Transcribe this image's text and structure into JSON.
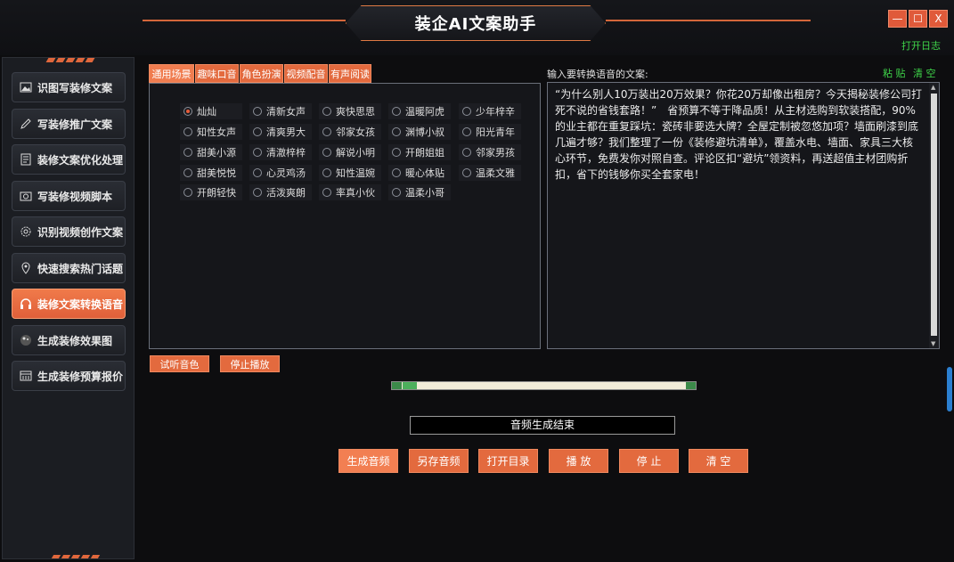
{
  "window": {
    "title": "装企AI文案助手",
    "open_log": "打开日志",
    "minimize": "—",
    "maximize": "☐",
    "close": "X"
  },
  "sidebar": {
    "items": [
      {
        "label": "识图写装修文案",
        "icon": "image-icon"
      },
      {
        "label": "写装修推广文案",
        "icon": "pen-icon"
      },
      {
        "label": "装修文案优化处理",
        "icon": "document-icon"
      },
      {
        "label": "写装修视频脚本",
        "icon": "camera-icon"
      },
      {
        "label": "识别视频创作文案",
        "icon": "gear-icon"
      },
      {
        "label": "快速搜索热门话题",
        "icon": "location-pin-icon"
      },
      {
        "label": "装修文案转换语音",
        "icon": "headphones-icon",
        "active": true
      },
      {
        "label": "生成装修效果图",
        "icon": "paint-icon"
      },
      {
        "label": "生成装修预算报价",
        "icon": "calculator-icon"
      }
    ]
  },
  "tabs": [
    {
      "label": "通用场景",
      "active": true
    },
    {
      "label": "趣味口音"
    },
    {
      "label": "角色扮演"
    },
    {
      "label": "视频配音"
    },
    {
      "label": "有声阅读"
    }
  ],
  "voices": [
    [
      "灿灿",
      "清新女声",
      "爽快思思",
      "温暖阿虎",
      "少年梓辛"
    ],
    [
      "知性女声",
      "清爽男大",
      "邻家女孩",
      "渊博小叔",
      "阳光青年"
    ],
    [
      "甜美小源",
      "清澈梓梓",
      "解说小明",
      "开朗姐姐",
      "邻家男孩"
    ],
    [
      "甜美悦悦",
      "心灵鸡汤",
      "知性温婉",
      "暖心体贴",
      "温柔文雅"
    ],
    [
      "开朗轻快",
      "活泼爽朗",
      "率真小伙",
      "温柔小哥"
    ]
  ],
  "selected_voice": "灿灿",
  "input": {
    "label": "输入要转换语音的文案:",
    "paste": "粘 贴",
    "clear": "清 空",
    "text": "“为什么别人10万装出20万效果？你花20万却像出租房？今天揭秘装修公司打死不说的省钱套路！”　省预算不等于降品质！从主材选购到软装搭配，90%的业主都在重复踩坑：瓷砖非要选大牌？全屋定制被忽悠加项？墙面刷漆到底几遍才够？我们整理了一份《装修避坑清单》，覆盖水电、墙面、家具三大核心环节，免费发你对照自查。评论区扣“避坑”领资料，再送超值主材团购折扣，省下的钱够你买全套家电！"
  },
  "controls": {
    "preview_voice": "试听音色",
    "stop_playback": "停止播放",
    "status": "音频生成结束",
    "progress": 0
  },
  "actions": {
    "generate": "生成音频",
    "save_as": "另存音频",
    "open_dir": "打开目录",
    "play": "播 放",
    "stop": "停 止",
    "clear": "清 空"
  },
  "colors": {
    "accent": "#e36a3e",
    "link_green": "#3fd64a"
  }
}
